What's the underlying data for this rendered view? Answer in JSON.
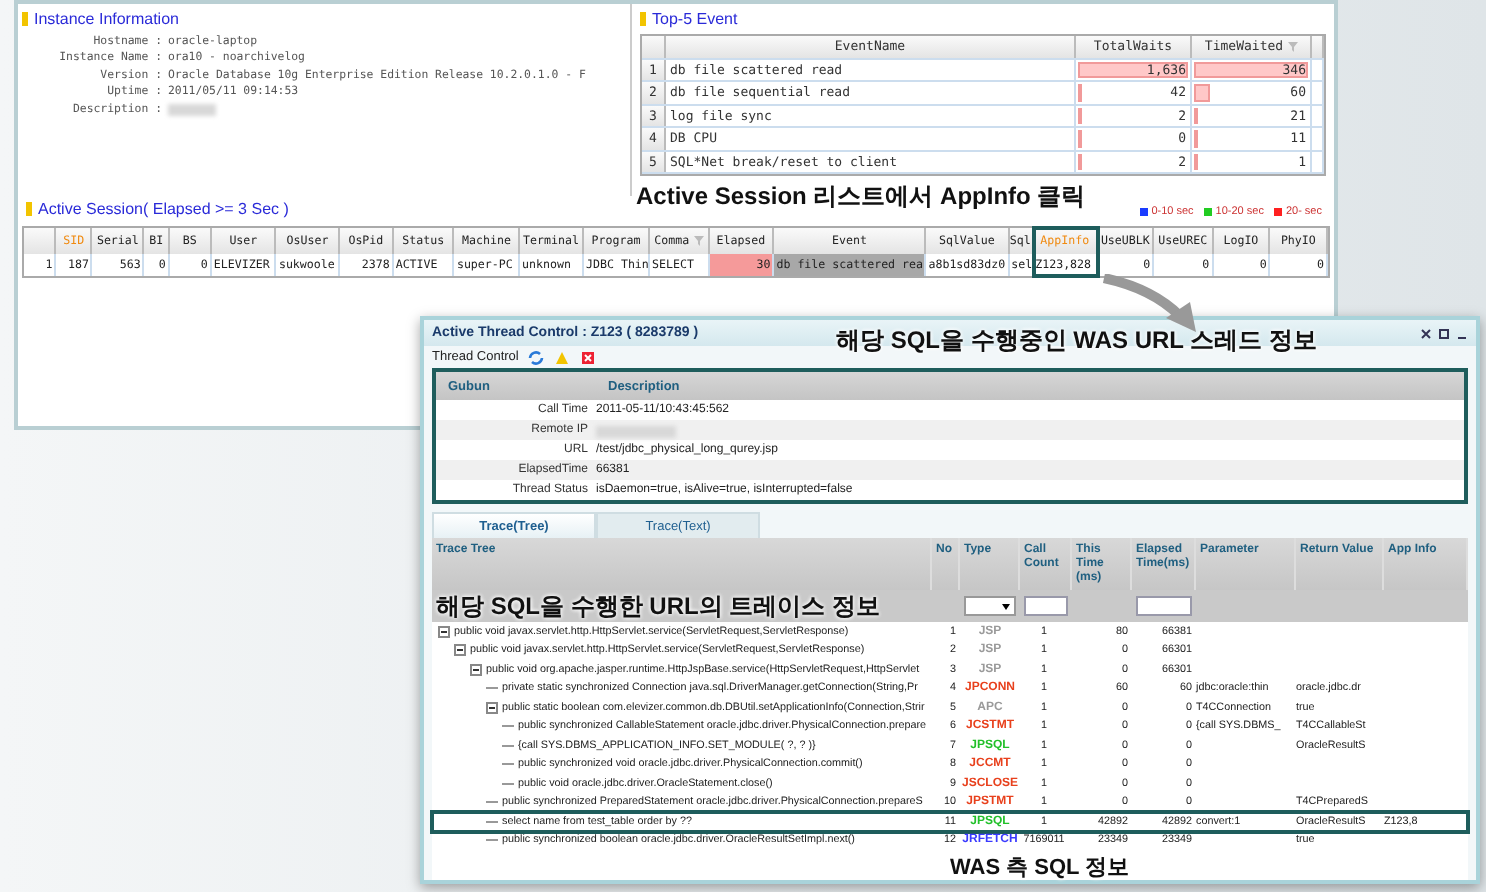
{
  "instance": {
    "title": "Instance Information",
    "fields": [
      {
        "label": "Hostname :",
        "value": "oracle-laptop"
      },
      {
        "label": "Instance Name :",
        "value": "ora10 - noarchivelog"
      },
      {
        "label": "Version :",
        "value": "Oracle Database 10g Enterprise Edition Release 10.2.0.1.0 - F"
      },
      {
        "label": "Uptime :",
        "value": "2011/05/11 09:14:53"
      },
      {
        "label": "Description :",
        "blurred": true
      }
    ]
  },
  "top5": {
    "title": "Top-5 Event",
    "columns": [
      "EventName",
      "TotalWaits",
      "TimeWaited"
    ],
    "rows": [
      {
        "no": "1",
        "name": "db file scattered read",
        "total_waits": "1,636",
        "total_level": {
          "level": 1
        },
        "time_waited": "346",
        "time_level": {
          "level": 1
        }
      },
      {
        "no": "2",
        "name": "db file sequential read",
        "total_waits": "42",
        "total_level": {
          "level": 0.03
        },
        "time_waited": "60",
        "time_level": {
          "level": 0.17
        }
      },
      {
        "no": "3",
        "name": "log file sync",
        "total_waits": "2",
        "total_level": {
          "level": 0
        },
        "time_waited": "21",
        "time_level": {
          "level": 0.06
        }
      },
      {
        "no": "4",
        "name": "DB CPU",
        "total_waits": "0",
        "total_level": {
          "level": 0
        },
        "time_waited": "11",
        "time_level": {
          "level": 0.03
        }
      },
      {
        "no": "5",
        "name": "SQL*Net break/reset to client",
        "total_waits": "2",
        "total_level": {
          "level": 0
        },
        "time_waited": "1",
        "time_level": {
          "level": 0
        }
      }
    ]
  },
  "session": {
    "title": "Active Session( Elapsed >= 3 Sec )",
    "legend": [
      {
        "label": "0-10 sec",
        "color": "#1a3cff"
      },
      {
        "label": "10-20 sec",
        "color": "#22cc22"
      },
      {
        "label": "20- sec",
        "color": "#ff2020"
      }
    ],
    "columns": [
      {
        "label": "SID",
        "highlighted": true,
        "framed": false
      },
      {
        "label": "Serial",
        "highlighted": false,
        "framed": false
      },
      {
        "label": "BI",
        "highlighted": false,
        "framed": false
      },
      {
        "label": "BS",
        "highlighted": false,
        "framed": false
      },
      {
        "label": "User",
        "highlighted": false,
        "framed": false
      },
      {
        "label": "OsUser",
        "highlighted": false,
        "framed": false
      },
      {
        "label": "OsPid",
        "highlighted": false,
        "framed": false
      },
      {
        "label": "Status",
        "highlighted": false,
        "framed": false
      },
      {
        "label": "Machine",
        "highlighted": false,
        "framed": false
      },
      {
        "label": "Terminal",
        "highlighted": false,
        "framed": false
      },
      {
        "label": "Program",
        "highlighted": false,
        "framed": false
      },
      {
        "label": "Comma",
        "highlighted": false,
        "framed": false
      },
      {
        "label": "Elapsed",
        "highlighted": false,
        "framed": false
      },
      {
        "label": "Event",
        "highlighted": false,
        "framed": false
      },
      {
        "label": "SqlValue",
        "highlighted": false,
        "framed": false
      },
      {
        "label": "Sql",
        "highlighted": false,
        "framed": false
      },
      {
        "label": "AppInfo",
        "highlighted": true,
        "framed": true
      },
      {
        "label": "UseUBLK",
        "highlighted": false,
        "framed": false
      },
      {
        "label": "UseUREC",
        "highlighted": false,
        "framed": false
      },
      {
        "label": "LogIO",
        "highlighted": false,
        "framed": false
      },
      {
        "label": "PhyIO",
        "highlighted": false,
        "framed": false
      }
    ],
    "rows": [
      {
        "no": "1",
        "cells": [
          {
            "text": "187",
            "kind": "number"
          },
          {
            "text": "563",
            "kind": "number"
          },
          {
            "text": "0",
            "kind": "number"
          },
          {
            "text": "0",
            "kind": "number"
          },
          {
            "text": "ELEVIZER",
            "kind": "text"
          },
          {
            "text": "sukwoole",
            "kind": "text"
          },
          {
            "text": "2378",
            "kind": "number"
          },
          {
            "text": "ACTIVE",
            "kind": "text"
          },
          {
            "text": "super-PC",
            "kind": "text"
          },
          {
            "text": "unknown",
            "kind": "text"
          },
          {
            "text": "JDBC Thin",
            "kind": "text"
          },
          {
            "text": "SELECT",
            "kind": "text"
          },
          {
            "text": "30",
            "kind": "alert"
          },
          {
            "text": "db file scattered rea",
            "kind": "shade"
          },
          {
            "text": "a8b1sd83dz0",
            "kind": "text"
          },
          {
            "text": "sel",
            "kind": "text"
          },
          {
            "text": "Z123,828",
            "kind": "text"
          },
          {
            "text": "0",
            "kind": "number"
          },
          {
            "text": "0",
            "kind": "number"
          },
          {
            "text": "0",
            "kind": "number"
          },
          {
            "text": "0",
            "kind": "number"
          }
        ]
      }
    ]
  },
  "thread": {
    "title": "Active Thread Control : Z123 ( 8283789 )",
    "toolbar_label": "Thread Control",
    "info_columns": [
      "Gubun",
      "Description"
    ],
    "info": [
      {
        "label": "Call Time",
        "value": "2011-05-11/10:43:45:562"
      },
      {
        "label": "Remote IP",
        "blurred": true
      },
      {
        "label": "URL",
        "value": "/test/jdbc_physical_long_qurey.jsp"
      },
      {
        "label": "ElapsedTime",
        "value": "66381"
      },
      {
        "label": "Thread Status",
        "value": "isDaemon=true, isAlive=true, isInterrupted=false"
      }
    ],
    "tabs": [
      {
        "label": "Trace(Tree)",
        "selected": true
      },
      {
        "label": "Trace(Text)",
        "selected": false
      }
    ],
    "trace_columns": [
      "Trace Tree",
      "No",
      "Type",
      "Call Count",
      "This Time (ms)",
      "Elapsed Time(ms)",
      "Parameter",
      "Return Value",
      "App Info"
    ],
    "trace": [
      {
        "text": "public void javax.servlet.http.HttpServlet.service(ServletRequest,ServletResponse)",
        "no": "1",
        "type": "JSP",
        "color": "#9a9a9a",
        "count": "1",
        "this": "80",
        "elapsed": "66381",
        "expanded": true,
        "highlighted": false,
        "children": [
          {
            "text": "public void javax.servlet.http.HttpServlet.service(ServletRequest,ServletResponse)",
            "no": "2",
            "type": "JSP",
            "color": "#9a9a9a",
            "count": "1",
            "this": "0",
            "elapsed": "66301",
            "expanded": true,
            "highlighted": false,
            "children": [
              {
                "text": "public void org.apache.jasper.runtime.HttpJspBase.service(HttpServletRequest,HttpServlet",
                "no": "3",
                "type": "JSP",
                "color": "#9a9a9a",
                "count": "1",
                "this": "0",
                "elapsed": "66301",
                "expanded": true,
                "highlighted": false,
                "children": [
                  {
                    "text": "private static synchronized Connection java.sql.DriverManager.getConnection(String,Pr",
                    "no": "4",
                    "type": "JPCONN",
                    "color": "#e8401c",
                    "count": "1",
                    "this": "60",
                    "elapsed": "60",
                    "param": "jdbc:oracle:thin",
                    "ret": "oracle.jdbc.dr",
                    "highlighted": false
                  },
                  {
                    "text": "public static boolean com.elevizer.common.db.DBUtil.setApplicationInfo(Connection,Strir",
                    "no": "5",
                    "type": "APC",
                    "color": "#9a9a9a",
                    "count": "1",
                    "this": "0",
                    "elapsed": "0",
                    "param": "T4CConnection",
                    "ret": "true",
                    "expanded": true,
                    "highlighted": false,
                    "children": [
                      {
                        "text": "public synchronized CallableStatement oracle.jdbc.driver.PhysicalConnection.prepare",
                        "no": "6",
                        "type": "JCSTMT",
                        "color": "#e8401c",
                        "count": "1",
                        "this": "0",
                        "elapsed": "0",
                        "param": "{call SYS.DBMS_",
                        "ret": "T4CCallableSt",
                        "highlighted": false
                      },
                      {
                        "text": "{call SYS.DBMS_APPLICATION_INFO.SET_MODULE( ?, ? )}",
                        "no": "7",
                        "type": "JPSQL",
                        "color": "#22c02a",
                        "count": "1",
                        "this": "0",
                        "elapsed": "0",
                        "ret": "OracleResultS",
                        "highlighted": false
                      },
                      {
                        "text": "public synchronized void oracle.jdbc.driver.PhysicalConnection.commit()",
                        "no": "8",
                        "type": "JCCMT",
                        "color": "#e8401c",
                        "count": "1",
                        "this": "0",
                        "elapsed": "0",
                        "highlighted": false
                      },
                      {
                        "text": "public void oracle.jdbc.driver.OracleStatement.close()",
                        "no": "9",
                        "type": "JSCLOSE",
                        "color": "#e8401c",
                        "count": "1",
                        "this": "0",
                        "elapsed": "0",
                        "highlighted": false
                      }
                    ]
                  },
                  {
                    "text": "public synchronized PreparedStatement oracle.jdbc.driver.PhysicalConnection.prepareS",
                    "no": "10",
                    "type": "JPSTMT",
                    "color": "#e8401c",
                    "count": "1",
                    "this": "0",
                    "elapsed": "0",
                    "ret": "T4CPreparedS",
                    "highlighted": false
                  },
                  {
                    "text": "select name from test_table order by ??",
                    "no": "11",
                    "type": "JPSQL",
                    "color": "#22c02a",
                    "count": "1",
                    "this": "42892",
                    "elapsed": "42892",
                    "param": "convert:1",
                    "ret": "OracleResultS",
                    "app": "Z123,8",
                    "highlighted": true
                  },
                  {
                    "text": "public synchronized boolean oracle.jdbc.driver.OracleResultSetImpl.next()",
                    "no": "12",
                    "type": "JRFETCH",
                    "color": "#3a3aff",
                    "count": "7169011",
                    "this": "23349",
                    "elapsed": "23349",
                    "ret": "true",
                    "highlighted": false
                  }
                ]
              }
            ]
          }
        ]
      }
    ]
  },
  "annotations": [
    {
      "text": "Active Session 리스트에서 AppInfo 클릭"
    },
    {
      "text": "해당 SQL을 수행중인 WAS URL 스레드 정보"
    },
    {
      "text": "해당 SQL을 수행한 URL의 트레이스 정보"
    },
    {
      "text": "WAS 측 SQL 정보"
    }
  ]
}
